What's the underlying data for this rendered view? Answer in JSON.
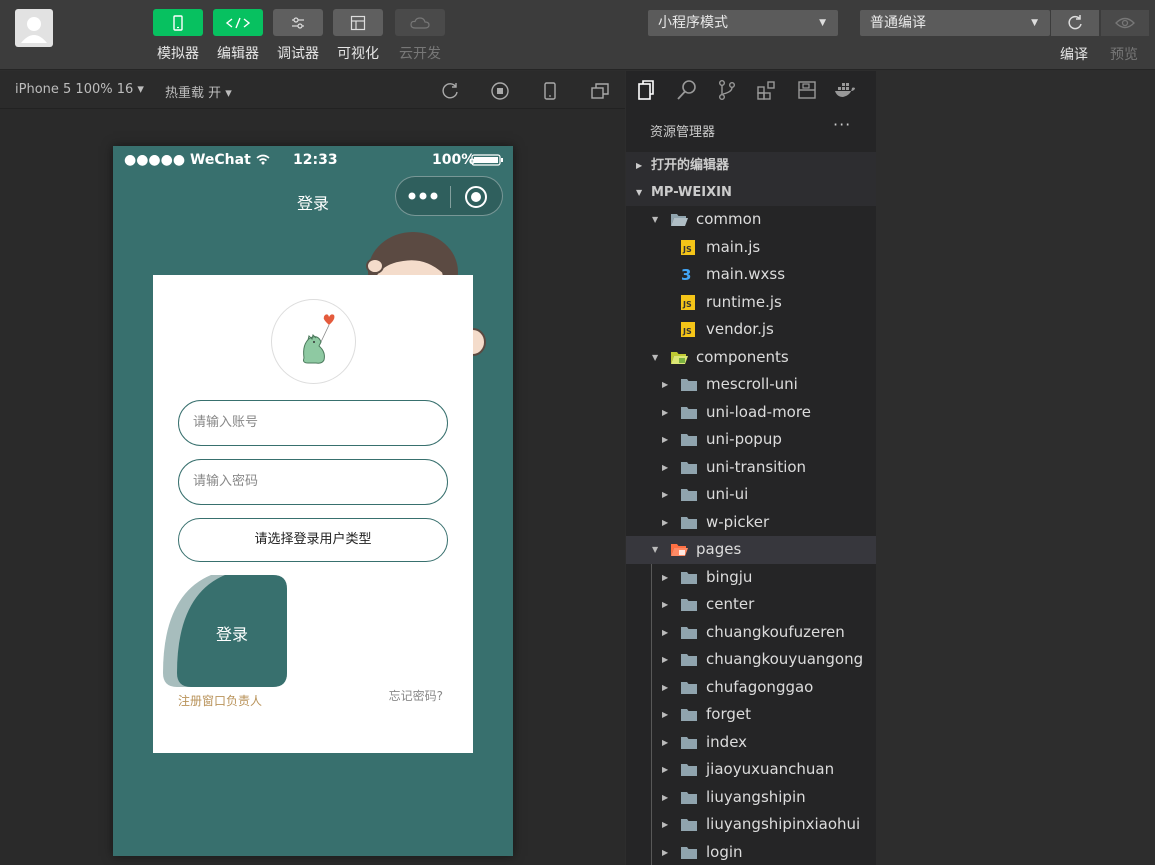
{
  "toolbar": {
    "buttons": [
      {
        "label": "模拟器",
        "icon": "phone-icon"
      },
      {
        "label": "编辑器",
        "icon": "code-icon"
      },
      {
        "label": "调试器",
        "icon": "debug-icon"
      },
      {
        "label": "可视化",
        "icon": "layout-icon"
      },
      {
        "label": "云开发",
        "icon": "cloud-icon"
      }
    ],
    "mode_select": "小程序模式",
    "compile_select": "普通编译",
    "compile_label": "编译",
    "preview_label": "预览"
  },
  "simbar": {
    "device": "iPhone 5 100% 16",
    "hot_reload": "热重载 开"
  },
  "phone": {
    "carrier": "●●●●● WeChat",
    "time": "12:33",
    "battery": "100%",
    "nav_title": "登录",
    "account_placeholder": "请输入账号",
    "password_placeholder": "请输入密码",
    "user_type_button": "请选择登录用户类型",
    "login_button": "登录",
    "register_link": "注册窗口负责人",
    "forgot_link": "忘记密码?"
  },
  "explorer": {
    "title": "资源管理器",
    "more": "···",
    "open_editors": "打开的编辑器",
    "project": "MP-WEIXIN",
    "tree": [
      {
        "label": "common",
        "type": "folder-open",
        "depth": 1
      },
      {
        "label": "main.js",
        "type": "js",
        "depth": 2
      },
      {
        "label": "main.wxss",
        "type": "css",
        "depth": 2
      },
      {
        "label": "runtime.js",
        "type": "js",
        "depth": 2
      },
      {
        "label": "vendor.js",
        "type": "js",
        "depth": 2
      },
      {
        "label": "components",
        "type": "folder-open-green",
        "depth": 1
      },
      {
        "label": "mescroll-uni",
        "type": "folder",
        "depth": 2
      },
      {
        "label": "uni-load-more",
        "type": "folder",
        "depth": 2
      },
      {
        "label": "uni-popup",
        "type": "folder",
        "depth": 2
      },
      {
        "label": "uni-transition",
        "type": "folder",
        "depth": 2
      },
      {
        "label": "uni-ui",
        "type": "folder",
        "depth": 2
      },
      {
        "label": "w-picker",
        "type": "folder",
        "depth": 2
      },
      {
        "label": "pages",
        "type": "folder-open-orange",
        "depth": 1
      },
      {
        "label": "bingju",
        "type": "folder",
        "depth": 2
      },
      {
        "label": "center",
        "type": "folder",
        "depth": 2
      },
      {
        "label": "chuangkoufuzeren",
        "type": "folder",
        "depth": 2
      },
      {
        "label": "chuangkouyuangong",
        "type": "folder",
        "depth": 2
      },
      {
        "label": "chufagonggao",
        "type": "folder",
        "depth": 2
      },
      {
        "label": "forget",
        "type": "folder",
        "depth": 2
      },
      {
        "label": "index",
        "type": "folder",
        "depth": 2
      },
      {
        "label": "jiaoyuxuanchuan",
        "type": "folder",
        "depth": 2
      },
      {
        "label": "liuyangshipin",
        "type": "folder",
        "depth": 2
      },
      {
        "label": "liuyangshipinxiaohui",
        "type": "folder",
        "depth": 2
      },
      {
        "label": "login",
        "type": "folder",
        "depth": 2
      }
    ]
  },
  "colors": {
    "accent_green": "#07c160",
    "phone_bg": "#38706e",
    "register_link": "#b9935a"
  }
}
